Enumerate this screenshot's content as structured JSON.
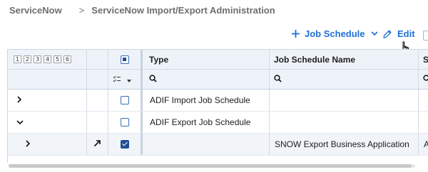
{
  "breadcrumb": {
    "root": "ServiceNow",
    "separator": ">",
    "current": "ServiceNow Import/Export Administration"
  },
  "toolbar": {
    "job_schedule_label": "Job Schedule",
    "edit_label": "Edit"
  },
  "grid": {
    "level_buttons": [
      "1",
      "2",
      "3",
      "4",
      "5",
      "6"
    ],
    "columns": {
      "type": "Type",
      "job_schedule_name": "Job Schedule Name",
      "next": "S"
    },
    "rows": [
      {
        "type": "ADIF Import Job Schedule",
        "name": "",
        "next": "",
        "expanded": false,
        "checked": false
      },
      {
        "type": "ADIF Export Job Schedule",
        "name": "",
        "next": "",
        "expanded": true,
        "checked": false
      },
      {
        "type": "",
        "name": "SNOW Export Business Application",
        "next": "A",
        "expanded": false,
        "checked": true
      }
    ]
  },
  "colors": {
    "accent": "#1f6fd6",
    "header_bg": "#eef3f9",
    "checkbox": "#1f4f93"
  }
}
